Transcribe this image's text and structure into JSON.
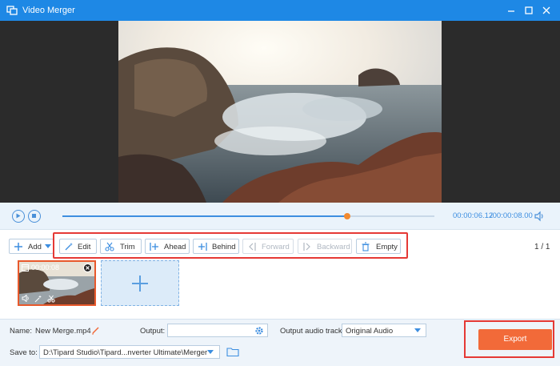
{
  "window": {
    "title": "Video Merger",
    "accent_color": "#1e88e5"
  },
  "player": {
    "current_time": "00:00:06.12",
    "total_time": "/00:00:08.00",
    "progress": 0.765
  },
  "toolbar": {
    "add": "Add",
    "edit": "Edit",
    "trim": "Trim",
    "ahead": "Ahead",
    "behind": "Behind",
    "forward": "Forward",
    "backward": "Backward",
    "empty": "Empty"
  },
  "pagination": "1 / 1",
  "clips": [
    {
      "duration": "00:00:08"
    }
  ],
  "footer": {
    "name_label": "Name:",
    "name_value": "New Merge.mp4",
    "output_label": "Output:",
    "output_value": "",
    "audio_label": "Output audio track:",
    "audio_value": "Original Audio",
    "save_label": "Save to:",
    "save_value": "D:\\Tipard Studio\\Tipard...nverter Ultimate\\Merger",
    "export": "Export"
  }
}
